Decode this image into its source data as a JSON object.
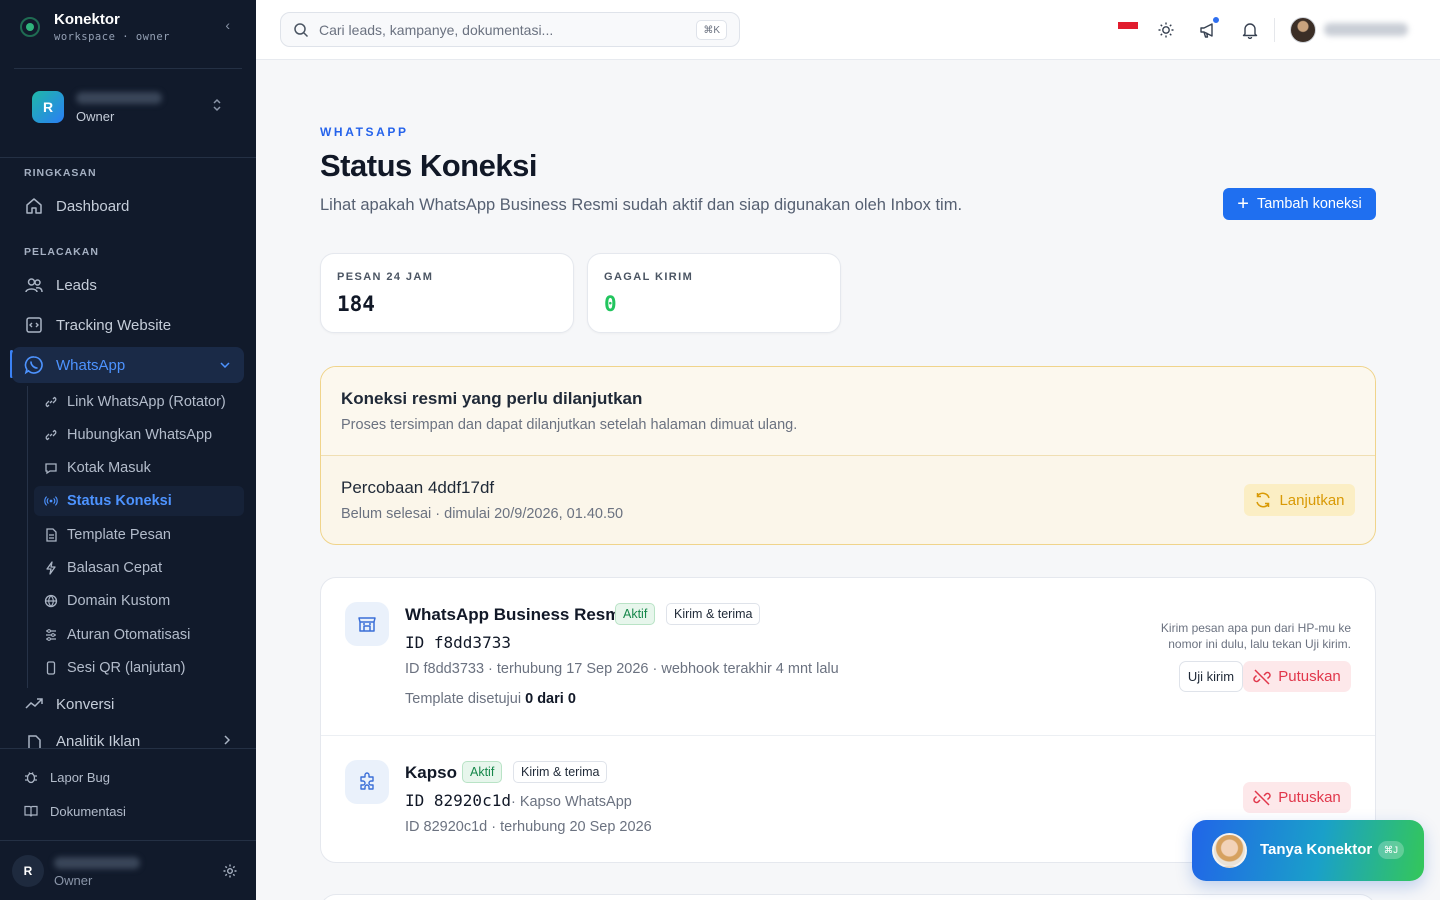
{
  "brand": {
    "name": "Konektor",
    "subtitle": "workspace · owner"
  },
  "workspace": {
    "initial": "R",
    "role": "Owner"
  },
  "sidebar": {
    "sections": [
      {
        "label": "RINGKASAN"
      },
      {
        "label": "PELACAKAN"
      }
    ],
    "items": {
      "dashboard": "Dashboard",
      "leads": "Leads",
      "tracking": "Tracking Website",
      "whatsapp": "WhatsApp",
      "konversi": "Konversi",
      "analitik": "Analitik Iklan"
    },
    "whatsapp_sub": [
      "Link WhatsApp (Rotator)",
      "Hubungkan WhatsApp",
      "Kotak Masuk",
      "Status Koneksi",
      "Template Pesan",
      "Balasan Cepat",
      "Domain Kustom",
      "Aturan Otomatisasi",
      "Sesi QR (lanjutan)"
    ],
    "bottom": {
      "bug": "Lapor Bug",
      "docs": "Dokumentasi"
    },
    "user": {
      "initial": "R",
      "role": "Owner"
    }
  },
  "topbar": {
    "search_placeholder": "Cari leads, kampanye, dokumentasi...",
    "search_shortcut": "⌘K"
  },
  "page": {
    "eyebrow": "WHATSAPP",
    "title": "Status Koneksi",
    "description": "Lihat apakah WhatsApp Business Resmi sudah aktif dan siap digunakan oleh Inbox tim.",
    "add_button": "Tambah koneksi"
  },
  "stats": [
    {
      "label": "PESAN 24 JAM",
      "value": "184",
      "color": "#111827"
    },
    {
      "label": "GAGAL KIRIM",
      "value": "0",
      "color": "#22c55e"
    }
  ],
  "resume": {
    "title": "Koneksi resmi yang perlu dilanjutkan",
    "subtitle": "Proses tersimpan dan dapat dilanjutkan setelah halaman dimuat ulang.",
    "attempt_title": "Percobaan 4ddf17df",
    "attempt_sub": "Belum selesai · dimulai 20/9/2026, 01.40.50",
    "button": "Lanjutkan"
  },
  "connections": [
    {
      "name": "WhatsApp Business Resmi",
      "status": "Aktif",
      "mode": "Kirim & terima",
      "id_label": "ID f8dd3733",
      "meta": "ID f8dd3733 · terhubung 17 Sep 2026 · webhook terakhir 4 mnt lalu",
      "template_label": "Template disetujui",
      "template_value": "0 dari 0",
      "hint": "Kirim pesan apa pun dari HP-mu ke nomor ini dulu, lalu tekan Uji kirim.",
      "test_button": "Uji kirim",
      "disconnect_button": "Putuskan"
    },
    {
      "name": "Kapso",
      "status": "Aktif",
      "mode": "Kirim & terima",
      "id_label": "ID 82920c1d",
      "id_suffix": "· Kapso WhatsApp",
      "meta": "ID 82920c1d · terhubung 20 Sep 2026",
      "disconnect_button": "Putuskan"
    }
  ],
  "assistant": {
    "label": "Tanya Konektor",
    "shortcut": "⌘J"
  },
  "colors": {
    "accent": "#1f6ff0",
    "sidebar_bg": "#111a2b",
    "success": "#22c55e",
    "danger": "#e1374b",
    "warning": "#d99a06"
  }
}
